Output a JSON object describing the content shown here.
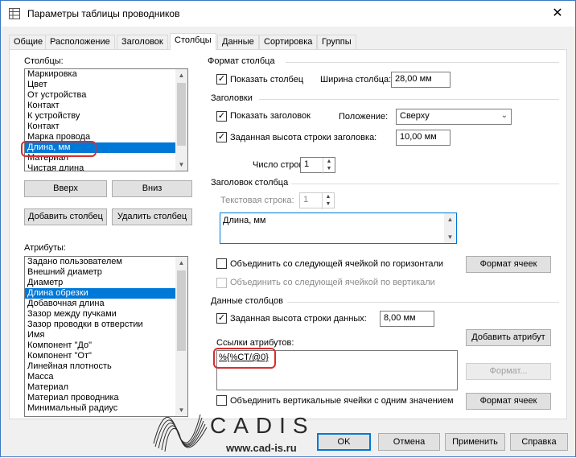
{
  "window": {
    "title": "Параметры таблицы проводников",
    "close_glyph": "✕"
  },
  "tabs": [
    "Общие",
    "Расположение",
    "Заголовок",
    "Столбцы",
    "Данные",
    "Сортировка",
    "Группы"
  ],
  "active_tab": "Столбцы",
  "columns_panel": {
    "label": "Столбцы:",
    "items": [
      "Маркировка",
      "Цвет",
      "От устройства",
      "Контакт",
      "К устройству",
      "Контакт",
      "Марка провода",
      "Длина, мм",
      "Материал",
      "Чистая длина"
    ],
    "selected_index": 7,
    "up_button": "Вверх",
    "down_button": "Вниз",
    "add_button": "Добавить столбец",
    "delete_button": "Удалить столбец"
  },
  "attributes_panel": {
    "label": "Атрибуты:",
    "items": [
      "Задано пользователем",
      "Внешний диаметр",
      "Диаметр",
      "Длина обрезки",
      "Добавочная длина",
      "Зазор между пучками",
      "Зазор проводки в отверстии",
      "Имя",
      "Компонент \"До\"",
      "Компонент \"От\"",
      "Линейная плотность",
      "Масса",
      "Материал",
      "Материал проводника",
      "Минимальный радиус"
    ],
    "selected_index": 3
  },
  "column_format": {
    "section_title": "Формат столбца",
    "show_column_label": "Показать столбец",
    "show_column_checked": true,
    "width_label": "Ширина столбца:",
    "width_value": "28,00 мм"
  },
  "headers": {
    "section_title": "Заголовки",
    "show_header_label": "Показать заголовок",
    "show_header_checked": true,
    "position_label": "Положение:",
    "position_value": "Сверху",
    "fixed_height_label": "Заданная высота строки заголовка:",
    "fixed_height_checked": true,
    "fixed_height_value": "10,00 мм",
    "rows_label": "Число строк:",
    "rows_value": "1"
  },
  "column_header": {
    "section_title": "Заголовок столбца",
    "text_row_label": "Текстовая строка:",
    "text_row_value": "1",
    "header_text": "Длина, мм",
    "merge_h_label": "Объединить со следующей ячейкой по горизонтали",
    "merge_v_label": "Объединить со следующей ячейкой по вертикали",
    "cell_format_button": "Формат ячеек"
  },
  "column_data": {
    "section_title": "Данные столбцов",
    "fixed_data_height_label": "Заданная высота строки данных:",
    "fixed_data_height_checked": true,
    "fixed_data_height_value": "8,00 мм",
    "attr_refs_label": "Ссылки атрибутов:",
    "attr_refs_value": "%{%CT/@0}",
    "add_attr_button": "Добавить атрибут",
    "format_button": "Формат...",
    "merge_vertical_label": "Объединить вертикальные ячейки с одним значением",
    "cell_format_button": "Формат ячеек"
  },
  "footer": {
    "ok": "OK",
    "cancel": "Отмена",
    "apply": "Применить",
    "help": "Справка"
  },
  "watermark": {
    "brand": "CADIS",
    "site": "www.cad-is.ru"
  },
  "colors": {
    "selection": "#0078d7",
    "highlight_ring": "#d32f2f",
    "window_border": "#3b78c4"
  }
}
